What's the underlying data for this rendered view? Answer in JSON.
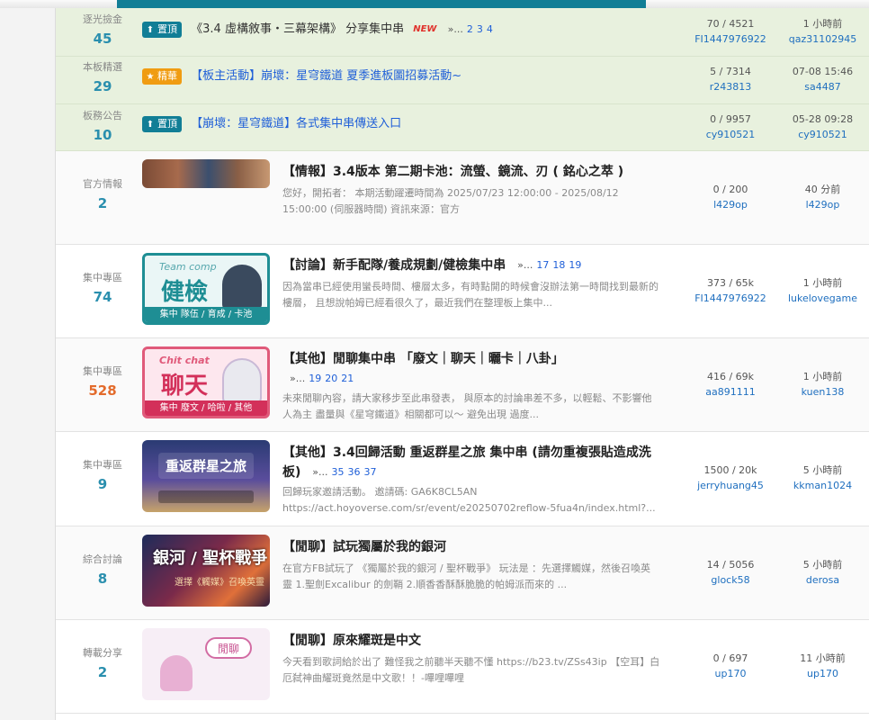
{
  "pinned_rows": [
    {
      "cat_name": "逐光撿金",
      "cat_count": "45",
      "badge": "置頂",
      "badge_icon": "arrow-up-icon",
      "title": "《3.4 虛構敘事・三幕架構》 分享集中串",
      "new_tag": "NEW",
      "page_ellipsis": "»...",
      "pages": [
        "2",
        "3",
        "4"
      ],
      "stats": "70 / 4521",
      "author": "FI1447976922",
      "last_time": "1 小時前",
      "last_user": "qaz31102945"
    },
    {
      "cat_name": "本板精選",
      "cat_count": "29",
      "badge": "精華",
      "badge_icon": "star-icon",
      "title": "【板主活動】崩壞：星穹鐵道 夏季進板圖招募活動~",
      "stats": "5 / 7314",
      "author": "r243813",
      "last_time": "07-08 15:46",
      "last_user": "sa4487"
    },
    {
      "cat_name": "板務公告",
      "cat_count": "10",
      "badge": "置頂",
      "badge_icon": "arrow-up-icon",
      "title": "【崩壞：星穹鐵道】各式集中串傳送入口",
      "stats": "0 / 9957",
      "author": "cy910521",
      "last_time": "05-28 09:28",
      "last_user": "cy910521"
    }
  ],
  "rows": [
    {
      "cat_name": "官方情報",
      "cat_count": "2",
      "title": "【情報】3.4版本 第二期卡池：流螢、鏡流、刃 ( 銘心之萃 )",
      "summary": "您好，開拓者： 本期活動躍遷時間為 2025/07/23 12:00:00 - 2025/08/12 15:00:00 (伺服器時間) 資訊來源：官方",
      "stats": "0 / 200",
      "author": "l429op",
      "last_time": "40 分前",
      "last_user": "l429op"
    },
    {
      "cat_name": "集中專區",
      "cat_count": "74",
      "title": "【討論】新手配隊/養成規劃/健檢集中串",
      "page_ellipsis": "»...",
      "pages": [
        "17",
        "18",
        "19"
      ],
      "summary": "因為當串已經使用蠻長時間、樓層太多，有時點開的時候會沒辦法第一時間找到最新的樓層， 且想說帕姆已經看很久了，最近我們在整理板上集中...",
      "thumb": {
        "en": "Team comp",
        "big": "健檢",
        "foot": "集中 隊伍 / 育成 / 卡池"
      },
      "stats": "373 / 65k",
      "author": "FI1447976922",
      "last_time": "1 小時前",
      "last_user": "lukelovegame"
    },
    {
      "cat_name": "集中專區",
      "cat_count": "528",
      "title": "【其他】閒聊集中串 「廢文｜聊天｜曬卡｜八卦」",
      "page_ellipsis": "»...",
      "pages": [
        "19",
        "20",
        "21"
      ],
      "summary": "未來閒聊內容，請大家移步至此串發表， 與原本的討論串差不多，以輕鬆、不影響他人為主 盡量與《星穹鐵道》相關都可以～ 避免出現 過度...",
      "thumb": {
        "en": "Chit chat",
        "big": "聊天",
        "foot": "集中 廢文 / 哈啦 / 其他"
      },
      "stats": "416 / 69k",
      "author": "aa891111",
      "last_time": "1 小時前",
      "last_user": "kuen138"
    },
    {
      "cat_name": "集中專區",
      "cat_count": "9",
      "title": "【其他】3.4回歸活動 重返群星之旅 集中串 (請勿重複張貼造成洗板)",
      "page_ellipsis": "»...",
      "pages": [
        "35",
        "36",
        "37"
      ],
      "summary": "回歸玩家邀請活動。 邀請碼: GA6K8CL5AN https://act.hoyoverse.com/sr/event/e20250702reflow-5fua4n/index.html?...",
      "thumb": {
        "big": "重返群星之旅"
      },
      "stats": "1500 / 20k",
      "author": "jerryhuang45",
      "last_time": "5 小時前",
      "last_user": "kkman1024"
    },
    {
      "cat_name": "綜合討論",
      "cat_count": "8",
      "title": "【閒聊】試玩獨屬於我的銀河",
      "summary": "在官方FB試玩了 《獨屬於我的銀河 / 聖杯戰爭》 玩法是 ：先選擇觸媒，然後召喚英靈 1.聖劍Excalibur 的劍鞘 2.順香香酥酥脆脆的帕姆派而來的 ...",
      "thumb": {
        "big": "銀河 / 聖杯戰爭",
        "sub": "選擇《觸媒》召喚英靈"
      },
      "stats": "14 / 5056",
      "author": "glock58",
      "last_time": "5 小時前",
      "last_user": "derosa"
    },
    {
      "cat_name": "轉載分享",
      "cat_count": "2",
      "title": "【閒聊】原來耀斑是中文",
      "summary": "今天看到歌詞給於出了 難怪我之前聽半天聽不懂 https://b23.tv/ZSs43ip 【空耳】白厄弑神曲耀斑竟然是中文歌！！-嗶哩嗶哩",
      "thumb": {
        "big": "閒聊"
      },
      "stats": "0 / 697",
      "author": "up170",
      "last_time": "11 小時前",
      "last_user": "up170"
    }
  ]
}
